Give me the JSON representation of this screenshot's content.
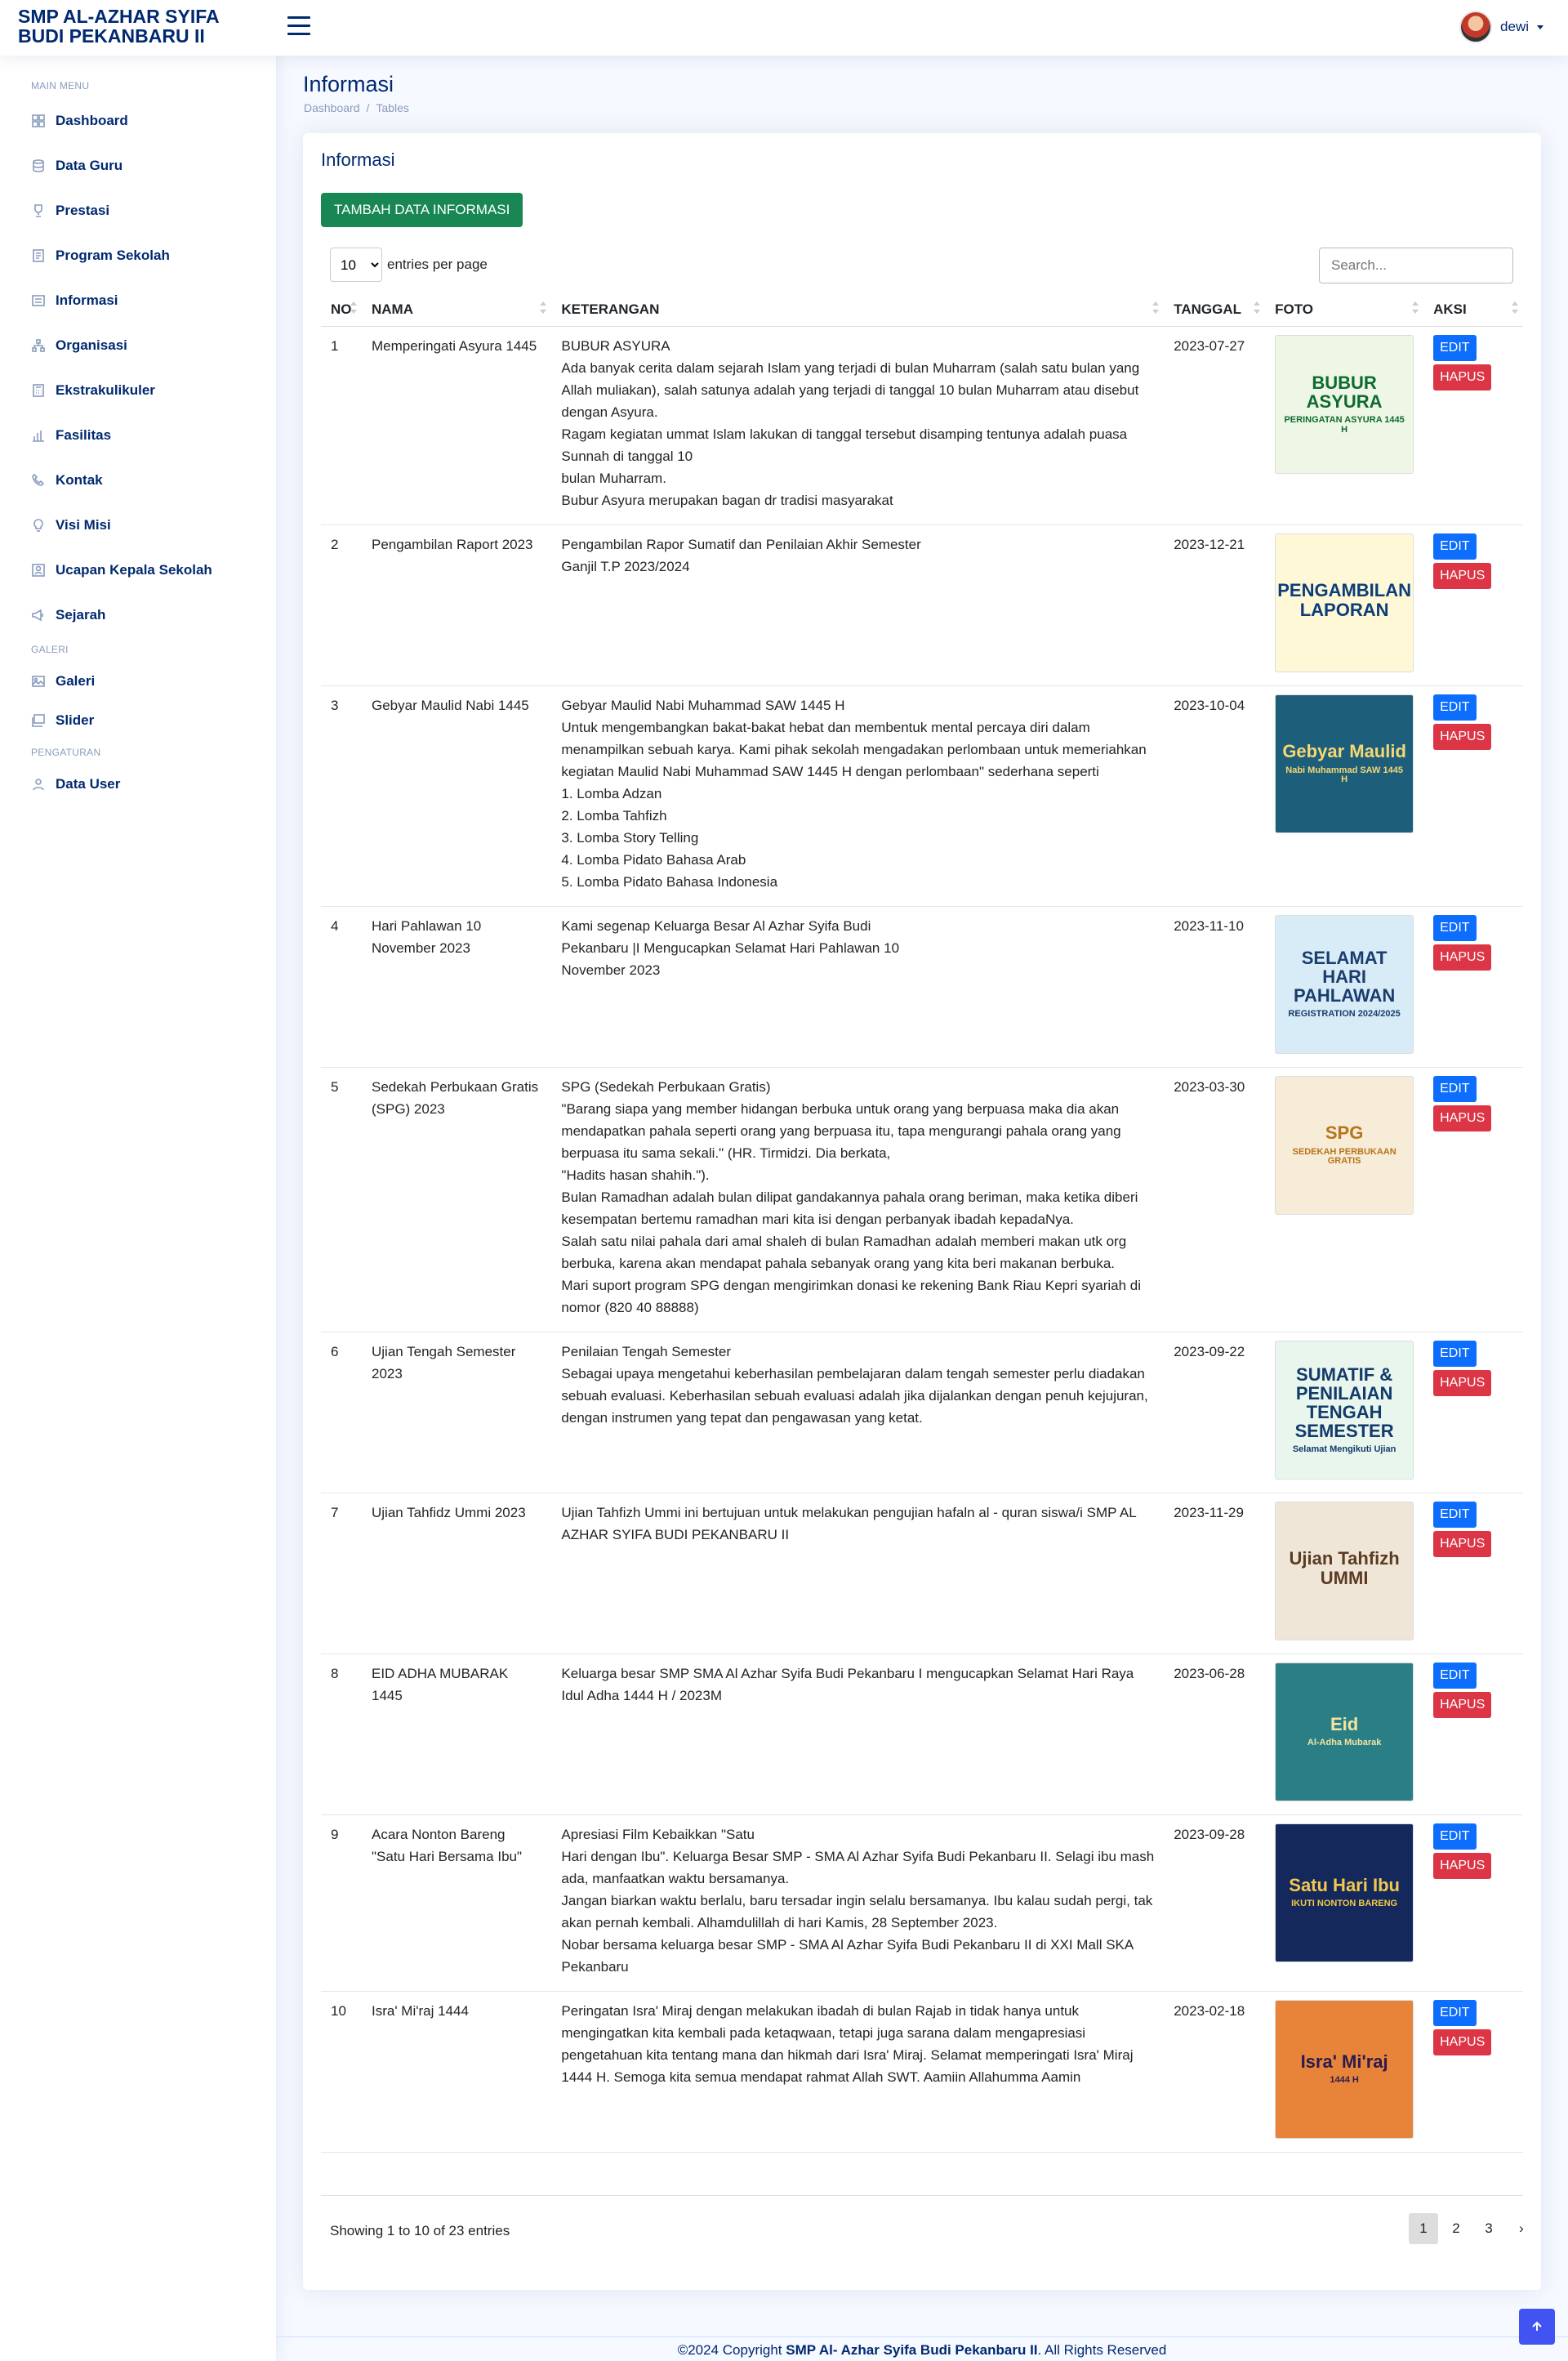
{
  "header": {
    "logo_line1": "SMP AL-AZHAR SYIFA",
    "logo_line2": "BUDI PEKANBARU II",
    "username": "dewi"
  },
  "sidebar": {
    "heading_main": "MAIN MENU",
    "heading_galeri": "GALERI",
    "heading_pengaturan": "PENGATURAN",
    "items": [
      {
        "label": "Dashboard",
        "icon": "grid-icon"
      },
      {
        "label": "Data Guru",
        "icon": "database-icon"
      },
      {
        "label": "Prestasi",
        "icon": "trophy-icon"
      },
      {
        "label": "Program Sekolah",
        "icon": "document-icon"
      },
      {
        "label": "Informasi",
        "icon": "list-icon"
      },
      {
        "label": "Organisasi",
        "icon": "diagram-icon"
      },
      {
        "label": "Ekstrakulikuler",
        "icon": "calculator-icon"
      },
      {
        "label": "Fasilitas",
        "icon": "bar-chart-icon"
      },
      {
        "label": "Kontak",
        "icon": "phone-icon"
      },
      {
        "label": "Visi Misi",
        "icon": "lightbulb-icon"
      },
      {
        "label": "Ucapan Kepala Sekolah",
        "icon": "person-box-icon"
      },
      {
        "label": "Sejarah",
        "icon": "megaphone-icon"
      },
      {
        "label": "Galeri",
        "icon": "image-icon"
      },
      {
        "label": "Slider",
        "icon": "images-icon"
      },
      {
        "label": "Data User",
        "icon": "user-icon"
      }
    ]
  },
  "page": {
    "title": "Informasi",
    "breadcrumb": [
      "Dashboard",
      "Tables"
    ],
    "card_title": "Informasi",
    "add_button": "TAMBAH DATA INFORMASI",
    "entries_value": "10",
    "entries_label": "entries per page",
    "search_placeholder": "Search...",
    "showing": "Showing 1 to 10 of 23 entries",
    "pages": [
      "1",
      "2",
      "3",
      "›"
    ]
  },
  "table": {
    "headers": [
      "NO",
      "NAMA",
      "KETERANGAN",
      "TANGGAL",
      "FOTO",
      "AKSI"
    ],
    "edit_label": "EDIT",
    "delete_label": "HAPUS",
    "rows": [
      {
        "no": "1",
        "nama": "Memperingati Asyura 1445",
        "keterangan": "BUBUR ASYURA\nAda banyak cerita dalam sejarah Islam yang terjadi di bulan Muharram (salah satu bulan yang Allah muliakan), salah satunya adalah yang terjadi di tanggal 10 bulan Muharram atau disebut dengan Asyura.\nRagam kegiatan ummat Islam lakukan di tanggal tersebut disamping tentunya adalah puasa Sunnah di tanggal 10\nbulan Muharram.\nBubur Asyura merupakan bagan dr tradisi masyarakat",
        "tanggal": "2023-07-27",
        "foto_text": "BUBUR ASYURA",
        "foto_sub": "PERINGATAN ASYURA 1445 H",
        "foto_bg": "#eef7e6",
        "foto_fg": "#0d6b2f"
      },
      {
        "no": "2",
        "nama": "Pengambilan Raport 2023",
        "keterangan": "Pengambilan Rapor Sumatif dan Penilaian Akhir Semester\nGanjil T.P 2023/2024",
        "tanggal": "2023-12-21",
        "foto_text": "PENGAMBILAN LAPORAN",
        "foto_sub": "",
        "foto_bg": "#fff8d6",
        "foto_fg": "#0a3d7a"
      },
      {
        "no": "3",
        "nama": "Gebyar Maulid Nabi 1445",
        "keterangan": "Gebyar Maulid Nabi Muhammad SAW 1445 H\nUntuk mengembangkan bakat-bakat hebat dan membentuk mental percaya diri dalam menampilkan sebuah karya. Kami pihak sekolah mengadakan perlombaan untuk memeriahkan kegiatan Maulid Nabi Muhammad SAW 1445 H dengan perlombaan\" sederhana seperti\n1. Lomba Adzan\n2. Lomba Tahfizh\n3. Lomba Story Telling\n4. Lomba Pidato Bahasa Arab\n5. Lomba Pidato Bahasa Indonesia",
        "tanggal": "2023-10-04",
        "foto_text": "Gebyar Maulid",
        "foto_sub": "Nabi Muhammad SAW 1445 H",
        "foto_bg": "#1d5f7a",
        "foto_fg": "#f7d774"
      },
      {
        "no": "4",
        "nama": "Hari Pahlawan 10 November 2023",
        "keterangan": "Kami segenap Keluarga Besar Al Azhar Syifa Budi\nPekanbaru  |I Mengucapkan Selamat Hari Pahlawan 10\nNovember 2023",
        "tanggal": "2023-11-10",
        "foto_text": "SELAMAT HARI PAHLAWAN",
        "foto_sub": "REGISTRATION 2024/2025",
        "foto_bg": "#d8ecf7",
        "foto_fg": "#1b3c6e"
      },
      {
        "no": "5",
        "nama": "Sedekah Perbukaan Gratis (SPG) 2023",
        "keterangan": "SPG (Sedekah Perbukaan Gratis)\n\"Barang siapa yang member hidangan berbuka untuk orang yang berpuasa maka dia akan mendapatkan pahala seperti orang yang berpuasa itu, tapa mengurangi pahala orang yang berpuasa itu sama sekali.\" (HR. Tirmidzi. Dia berkata,\n\"Hadits hasan shahih.\").\nBulan Ramadhan adalah bulan dilipat gandakannya pahala orang beriman, maka ketika diberi kesempatan bertemu ramadhan mari kita isi dengan perbanyak ibadah kepadaNya.\nSalah satu nilai pahala dari amal shaleh di bulan Ramadhan adalah memberi makan utk org berbuka, karena akan mendapat pahala sebanyak orang yang kita beri makanan berbuka.\nMari suport program SPG dengan mengirimkan donasi ke rekening Bank Riau Kepri syariah di nomor (820 40 88888)",
        "tanggal": "2023-03-30",
        "foto_text": "SPG",
        "foto_sub": "SEDEKAH PERBUKAAN GRATIS",
        "foto_bg": "#f6ecd8",
        "foto_fg": "#b8741a"
      },
      {
        "no": "6",
        "nama": "Ujian Tengah Semester 2023",
        "keterangan": "Penilaian Tengah Semester\nSebagai upaya mengetahui keberhasilan pembelajaran dalam tengah semester perlu diadakan sebuah evaluasi. Keberhasilan sebuah evaluasi adalah jika dijalankan dengan penuh kejujuran, dengan instrumen yang tepat dan pengawasan yang ketat.",
        "tanggal": "2023-09-22",
        "foto_text": "SUMATIF & PENILAIAN TENGAH SEMESTER",
        "foto_sub": "Selamat Mengikuti Ujian",
        "foto_bg": "#e9f6ee",
        "foto_fg": "#123a6b"
      },
      {
        "no": "7",
        "nama": "Ujian Tahfidz Ummi 2023",
        "keterangan": "Ujian Tahfizh Ummi ini bertujuan untuk melakukan pengujian hafaln al - quran siswa/i SMP AL AZHAR SYIFA BUDI PEKANBARU II",
        "tanggal": "2023-11-29",
        "foto_text": "Ujian Tahfizh UMMI",
        "foto_sub": "",
        "foto_bg": "#efe6d8",
        "foto_fg": "#5b3b22"
      },
      {
        "no": "8",
        "nama": "EID ADHA MUBARAK 1445",
        "keterangan": "Keluarga besar SMP SMA Al Azhar Syifa Budi Pekanbaru I mengucapkan Selamat Hari Raya Idul Adha 1444 H / 2023M",
        "tanggal": "2023-06-28",
        "foto_text": "Eid",
        "foto_sub": "Al-Adha Mubarak",
        "foto_bg": "#2a7f86",
        "foto_fg": "#f4e3a3"
      },
      {
        "no": "9",
        "nama": "Acara Nonton Bareng \"Satu Hari Bersama Ibu\"",
        "keterangan": "Apresiasi Film Kebaikkan \"Satu\nHari dengan Ibu\". Keluarga Besar SMP - SMA Al Azhar Syifa Budi Pekanbaru II. Selagi ibu mash ada, manfaatkan waktu bersamanya.\nJangan biarkan waktu berlalu, baru tersadar ingin selalu bersamanya. Ibu kalau sudah pergi, tak akan pernah kembali. Alhamdulillah di hari Kamis, 28 September 2023.\nNobar bersama keluarga besar SMP - SMA Al Azhar Syifa Budi Pekanbaru II di XXI Mall SKA Pekanbaru",
        "tanggal": "2023-09-28",
        "foto_text": "Satu Hari Ibu",
        "foto_sub": "IKUTI NONTON BARENG",
        "foto_bg": "#14285c",
        "foto_fg": "#f2c94c"
      },
      {
        "no": "10",
        "nama": "Isra' Mi'raj 1444",
        "keterangan": "Peringatan Isra' Miraj dengan melakukan ibadah di bulan Rajab in tidak hanya untuk mengingatkan kita kembali pada ketaqwaan, tetapi juga sarana dalam mengapresiasi pengetahuan kita tentang mana dan hikmah dari Isra' Miraj. Selamat memperingati Isra' Miraj 1444 H. Semoga kita semua mendapat rahmat Allah SWT. Aamiin Allahumma Aamin",
        "tanggal": "2023-02-18",
        "foto_text": "Isra' Mi'raj",
        "foto_sub": "1444 H",
        "foto_bg": "#e8843a",
        "foto_fg": "#2b1a4a"
      }
    ]
  },
  "footer": {
    "prefix": "©2024 Copyright ",
    "brand": "SMP Al- Azhar Syifa Budi Pekanbaru II",
    "suffix": ". All Rights Reserved"
  }
}
